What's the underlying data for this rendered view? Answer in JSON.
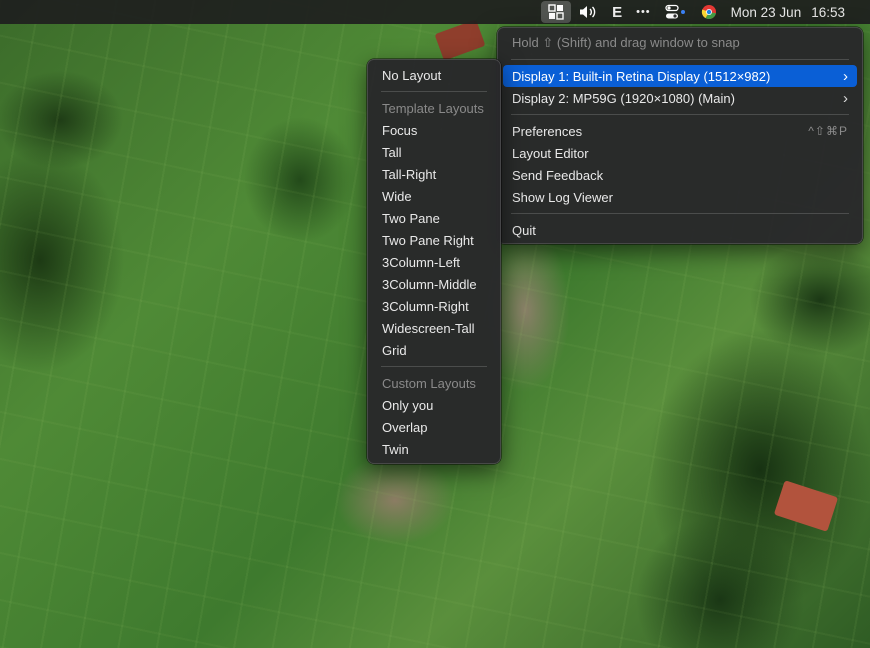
{
  "menubar": {
    "items": [
      {
        "name": "layout-manager-icon",
        "glyph": "▦"
      },
      {
        "name": "volume-icon",
        "glyph": "🔊︎"
      },
      {
        "name": "app-e-icon",
        "glyph": "E"
      },
      {
        "name": "more-icon",
        "glyph": "•••"
      },
      {
        "name": "control-center-icon",
        "glyph": "⊶"
      },
      {
        "name": "chrome-icon",
        "glyph": "◉"
      }
    ],
    "date": "Mon 23 Jun",
    "time": "16:53",
    "accent_color": "#0a5fd6"
  },
  "main_menu": {
    "hint": "Hold ⇧ (Shift) and drag window to snap",
    "display1": "Display 1: Built-in Retina Display (1512×982)",
    "display2": "Display 2: MP59G (1920×1080) (Main)",
    "chevron": "›",
    "preferences": "Preferences",
    "preferences_shortcut": "^⇧⌘P",
    "layout_editor": "Layout Editor",
    "send_feedback": "Send Feedback",
    "show_log_viewer": "Show Log Viewer",
    "quit": "Quit"
  },
  "sub_menu": {
    "no_layout": "No Layout",
    "template_header": "Template Layouts",
    "templates": [
      "Focus",
      "Tall",
      "Tall-Right",
      "Wide",
      "Two Pane",
      "Two Pane Right",
      "3Column-Left",
      "3Column-Middle",
      "3Column-Right",
      "Widescreen-Tall",
      "Grid"
    ],
    "custom_header": "Custom Layouts",
    "custom": [
      "Only you",
      "Overlap",
      "Twin"
    ]
  }
}
